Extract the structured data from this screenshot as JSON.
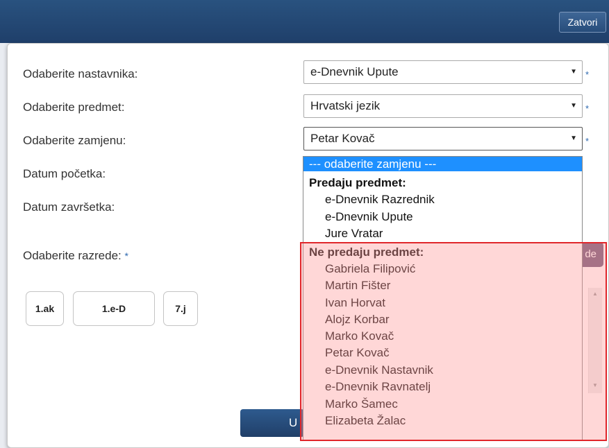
{
  "header": {
    "close_label": "Zatvori"
  },
  "form": {
    "teacher_label": "Odaberite nastavnika:",
    "teacher_value": "e-Dnevnik Upute",
    "subject_label": "Odaberite predmet:",
    "subject_value": "Hrvatski jezik",
    "substitute_label": "Odaberite zamjenu:",
    "substitute_value": "Petar Kovač",
    "start_date_label": "Datum početka:",
    "end_date_label": "Datum završetka:",
    "classes_label": "Odaberite razrede:",
    "required_mark": "*",
    "select_arrow": "▼",
    "classes": [
      "1.ak",
      "1.e-D",
      "7.j"
    ],
    "partial_button_text": "de",
    "partial_submit_text": "U"
  },
  "dropdown": {
    "selected_option": "--- odaberite zamjenu ---",
    "group_teaching": {
      "label": "Predaju predmet:",
      "items": [
        "e-Dnevnik Razrednik",
        "e-Dnevnik Upute",
        "Jure Vratar"
      ]
    },
    "group_not_teaching": {
      "label": "Ne predaju predmet:",
      "items": [
        "Gabriela Filipović",
        "Martin Fišter",
        "Ivan Horvat",
        "Alojz Korbar",
        "Marko Kovač",
        "Petar Kovač",
        "e-Dnevnik Nastavnik",
        "e-Dnevnik Ravnatelj",
        "Marko Šamec",
        "Elizabeta Žalac"
      ]
    }
  },
  "colors": {
    "header": "#1f3f6a",
    "dropdown_selected": "#1e90ff",
    "highlight_border": "#e0262b"
  }
}
